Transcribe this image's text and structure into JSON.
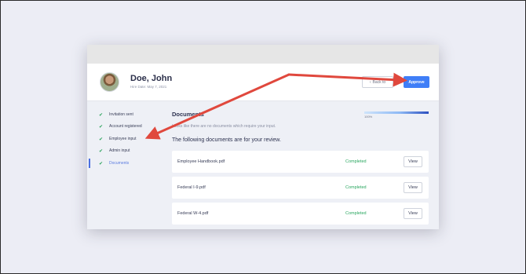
{
  "employee": {
    "name": "Doe, John",
    "hire_date": "Hire Date: May 7, 2021"
  },
  "header": {
    "back_label": "Back to",
    "back_icon": "chevron-left-icon",
    "approve_label": "Approve"
  },
  "sidebar": {
    "items": [
      {
        "label": "Invitation sent",
        "done": true
      },
      {
        "label": "Account registered",
        "done": true
      },
      {
        "label": "Employee input",
        "done": true
      },
      {
        "label": "Admin input",
        "done": true
      },
      {
        "label": "Documents",
        "done": false,
        "active": true
      }
    ]
  },
  "main": {
    "section_title": "Documents",
    "section_sub": "Looks like there are no documents which require your input.",
    "review_title": "The following documents are for your review.",
    "progress_value": 1.0,
    "progress_label": "100%",
    "documents": [
      {
        "name": "Employee Handbook.pdf",
        "status": "Completed",
        "action": "View"
      },
      {
        "name": "Federal I-9.pdf",
        "status": "Completed",
        "action": "View"
      },
      {
        "name": "Federal W-4.pdf",
        "status": "Completed",
        "action": "View"
      }
    ]
  },
  "colors": {
    "accent": "#3f7ef7",
    "success": "#2aa760",
    "annotation_arrow": "#e0483d"
  }
}
